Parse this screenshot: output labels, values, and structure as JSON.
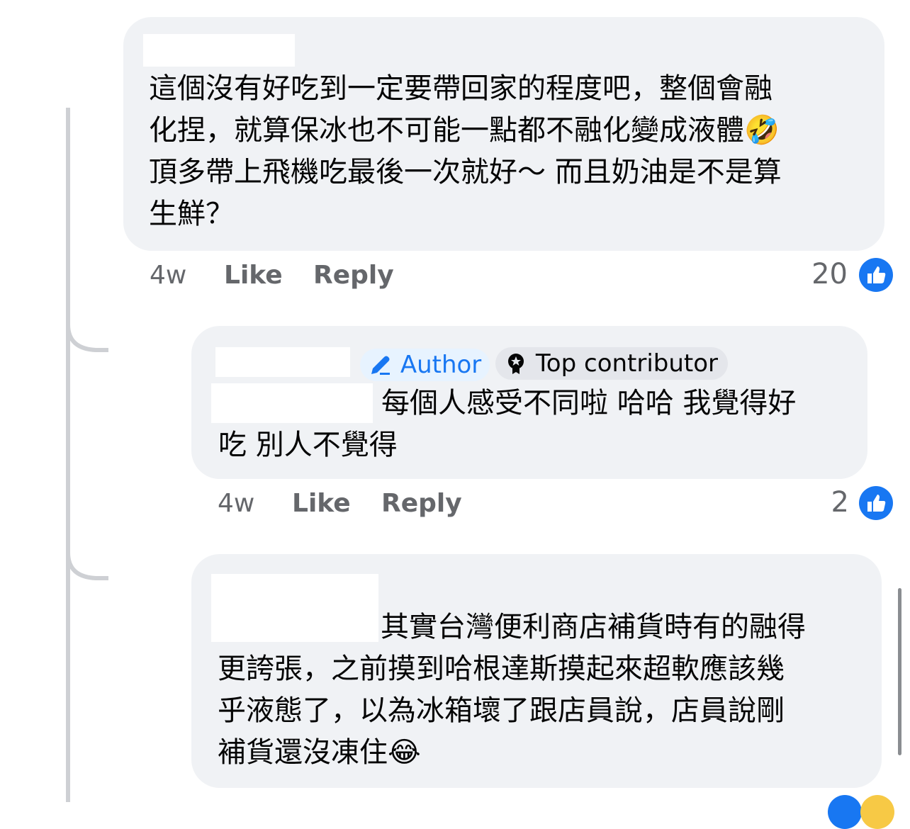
{
  "colors": {
    "bubble": "#f0f2f5",
    "like_blue": "#1877f2",
    "meta_text": "#65676b",
    "thread_line": "#ced0d4"
  },
  "comments": [
    {
      "lines": [
        "這個沒有好吃到一定要帶回家的程度吧，整個會融",
        "化捏，就算保冰也不可能一點都不融化變成液體",
        "頂多帶上飛機吃最後一次就好～ 而且奶油是不是算",
        "生鮮？"
      ],
      "emoji": "🤣",
      "time": "4w",
      "like_label": "Like",
      "reply_label": "Reply",
      "reaction_count": "20"
    },
    {
      "badges": {
        "author_label": "Author",
        "top_contributor_label": "Top contributor"
      },
      "lines": [
        "每個人感受不同啦 哈哈 我覺得好",
        "吃 別人不覺得"
      ],
      "time": "4w",
      "like_label": "Like",
      "reply_label": "Reply",
      "reaction_count": "2"
    },
    {
      "lines": [
        "其實台灣便利商店補貨時有的融得",
        "更誇張，之前摸到哈根達斯摸起來超軟應該幾",
        "乎液態了，以為冰箱壞了跟店員說，店員說剛",
        "補貨還沒凍住"
      ],
      "emoji": "😂"
    }
  ]
}
